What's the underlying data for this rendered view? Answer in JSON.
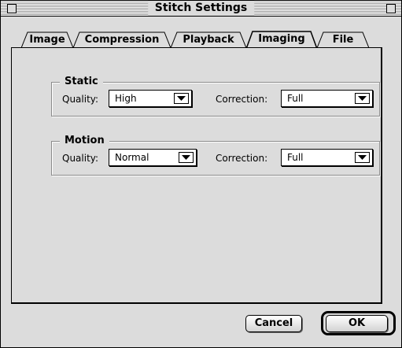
{
  "window": {
    "title": "Stitch Settings"
  },
  "tabs": [
    {
      "label": "Image",
      "selected": false
    },
    {
      "label": "Compression",
      "selected": false
    },
    {
      "label": "Playback",
      "selected": false
    },
    {
      "label": "Imaging",
      "selected": true
    },
    {
      "label": "File",
      "selected": false
    }
  ],
  "groups": {
    "static": {
      "title": "Static",
      "quality_label": "Quality:",
      "quality_value": "High",
      "correction_label": "Correction:",
      "correction_value": "Full"
    },
    "motion": {
      "title": "Motion",
      "quality_label": "Quality:",
      "quality_value": "Normal",
      "correction_label": "Correction:",
      "correction_value": "Full"
    }
  },
  "buttons": {
    "cancel_label": "Cancel",
    "ok_label": "OK",
    "default": "OK"
  },
  "icons": {
    "popup_arrow": "triangle-down-icon"
  }
}
